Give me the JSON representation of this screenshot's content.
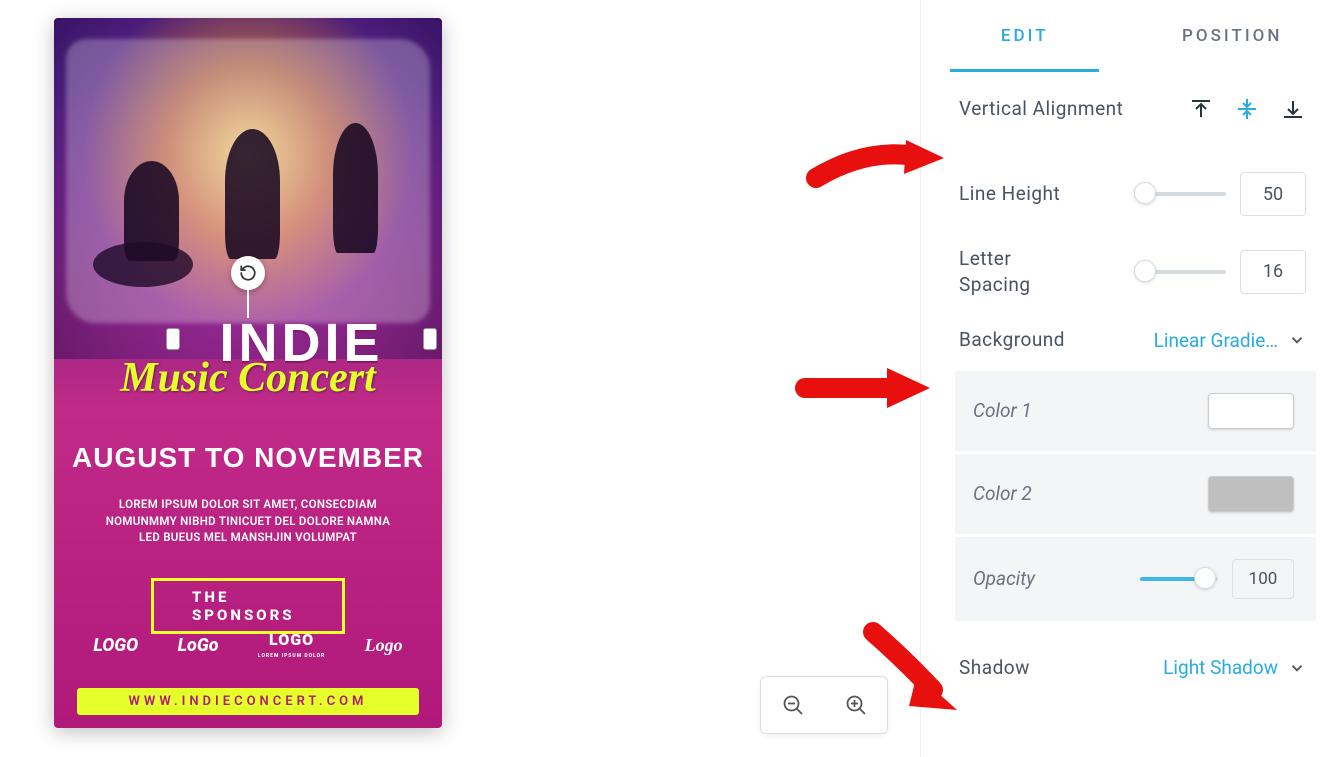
{
  "tabs": {
    "edit": "EDIT",
    "position": "POSITION",
    "active": "edit"
  },
  "panel": {
    "vertical_alignment_label": "Vertical Alignment",
    "vertical_alignment_value": "middle",
    "line_height": {
      "label": "Line Height",
      "value": "50",
      "pct": 0
    },
    "letter_spacing": {
      "label": "Letter Spacing",
      "value": "16",
      "pct": 0
    },
    "background": {
      "label": "Background",
      "dropdown_value": "Linear Gradie…",
      "color1_label": "Color 1",
      "color1_value": "#ffffff",
      "color2_label": "Color 2",
      "color2_value": "#bfbfbf",
      "opacity_label": "Opacity",
      "opacity_value": "100",
      "opacity_pct": 80
    },
    "shadow": {
      "label": "Shadow",
      "dropdown_value": "Light Shadow"
    }
  },
  "poster": {
    "title": "INDIE",
    "subtitle": "Music Concert",
    "dates": "AUGUST TO NOVEMBER",
    "lorem1": "LOREM IPSUM DOLOR SIT AMET, CONSECDIAM",
    "lorem2": "NOMUNMMY NIBHD TINICUET DEL DOLORE NAMNA",
    "lorem3": "LED BUEUS MEL MANSHJIN VOLUMPAT",
    "sponsors_label": "THE SPONSORS",
    "logos": [
      "LOGO",
      "LoGo",
      "LOGO",
      "Logo"
    ],
    "logo_sub": "LOREM IPSUM DOLOR",
    "url": "WWW.INDIECONCERT.COM"
  }
}
